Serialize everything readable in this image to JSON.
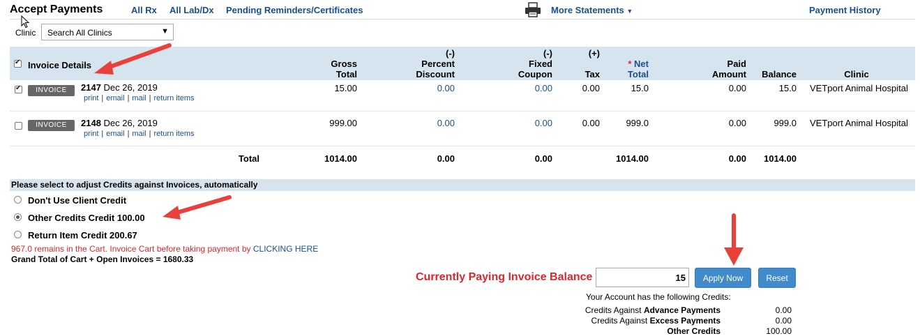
{
  "header": {
    "title": "Accept Payments",
    "nav_all_rx": "All Rx",
    "nav_all_labdx": "All Lab/Dx",
    "nav_pending": "Pending Reminders/Certificates",
    "nav_more_statements": "More Statements",
    "nav_payment_history": "Payment History"
  },
  "clinic": {
    "label": "Clinic",
    "selected": "Search All Clinics"
  },
  "table": {
    "col_invoice_details": "Invoice Details",
    "col_gross_1": "Gross",
    "col_gross_2": "Total",
    "col_pct_0": "(-)",
    "col_pct_1": "Percent",
    "col_pct_2": "Discount",
    "col_fixed_0": "(-)",
    "col_fixed_1": "Fixed",
    "col_fixed_2": "Coupon",
    "col_tax_0": "(+)",
    "col_tax_2": "Tax",
    "col_net_star": "*",
    "col_net_1": "Net",
    "col_net_2": "Total",
    "col_paid_1": "Paid",
    "col_paid_2": "Amount",
    "col_balance": "Balance",
    "col_clinic": "Clinic",
    "rows": [
      {
        "checked": true,
        "button": "INVOICE",
        "number": "2147",
        "date": "Dec 26, 2019",
        "link_print": "print",
        "link_email": "email",
        "link_mail": "mail",
        "link_return": "return items",
        "gross": "15.00",
        "percent": "0.00",
        "fixed": "0.00",
        "tax": "0.00",
        "net": "15.0",
        "paid": "0.00",
        "balance": "15.0",
        "clinic": "VETport Animal Hospital"
      },
      {
        "checked": false,
        "button": "INVOICE",
        "number": "2148",
        "date": "Dec 26, 2019",
        "link_print": "print",
        "link_email": "email",
        "link_mail": "mail",
        "link_return": "return items",
        "gross": "999.00",
        "percent": "0.00",
        "fixed": "0.00",
        "tax": "0.00",
        "net": "999.0",
        "paid": "0.00",
        "balance": "999.0",
        "clinic": "VETport Animal Hospital"
      }
    ],
    "total": {
      "label": "Total",
      "gross": "1014.00",
      "percent": "0.00",
      "fixed": "0.00",
      "net": "1014.00",
      "paid": "0.00",
      "balance": "1014.00"
    }
  },
  "credits": {
    "header": "Please select to adjust Credits against Invoices, automatically",
    "options": [
      {
        "label": "Don't Use Client Credit",
        "selected": false
      },
      {
        "label": "Other Credits Credit 100.00",
        "selected": true
      },
      {
        "label": "Return Item Credit 200.67",
        "selected": false
      }
    ],
    "cart_note_prefix": "967.0 remains in the Cart. Invoice Cart before taking payment by ",
    "cart_note_link": "CLICKING HERE",
    "grand_total": "Grand Total of Cart + Open Invoices = 1680.33"
  },
  "payment": {
    "label": "Currently Paying Invoice Balance",
    "amount": "15",
    "apply_button": "Apply Now",
    "reset_button": "Reset",
    "account_note": "Your Account has the following Credits:",
    "advance_prefix": "Credits Against ",
    "advance_bold": "Advance Payments",
    "advance_value": "0.00",
    "excess_prefix": "Credits Against ",
    "excess_bold": "Excess Payments",
    "excess_value": "0.00",
    "other_label": "Other Credits",
    "other_value": "100.00"
  },
  "colors": {
    "header_band": "#d6e4ef",
    "link_blue": "#1a4f8a",
    "alert_red": "#e0262b",
    "button_blue": "#428bca",
    "arrow_red": "#e8413b"
  }
}
